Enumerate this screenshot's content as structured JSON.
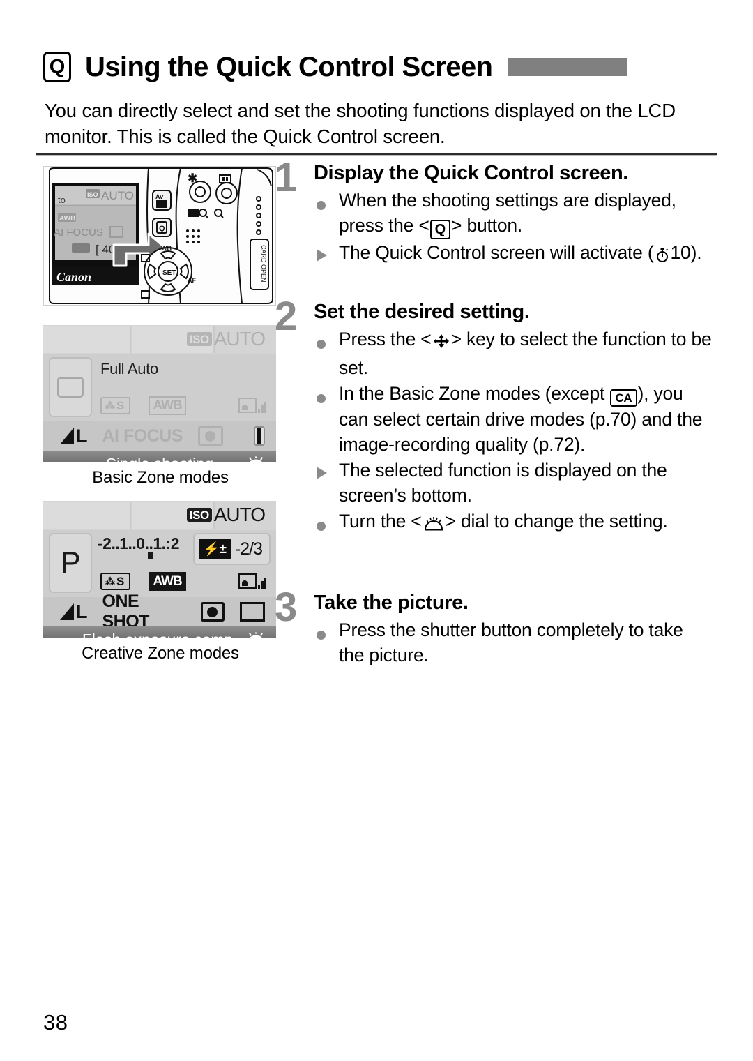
{
  "header": {
    "icon": "q-button-icon",
    "icon_label": "Q",
    "title": "Using the Quick Control Screen",
    "accent_bar_color": "#808080"
  },
  "intro": "You can directly select and set the shooting functions displayed on the LCD monitor. This is called the Quick Control screen.",
  "figures": {
    "camera": {
      "name": "camera-back-photo",
      "lcd_texts": {
        "mode": "to",
        "iso": "AUTO",
        "wb": "AWB",
        "af": "AI FOCUS",
        "iso_value": "400",
        "brand": "Canon"
      },
      "button_labels": {
        "exposure": "Av",
        "quick_control": "Q",
        "wb": "WB",
        "af": "AF",
        "set": "SET"
      },
      "card_door_label": "CARD OPEN"
    },
    "basic_zone": {
      "caption": "Basic Zone modes",
      "iso_tag": "ISO",
      "iso_value": "AUTO",
      "mode_name": "Full Auto",
      "picture_style": "S",
      "white_balance": "AWB",
      "quality": "L",
      "af_mode": "AI FOCUS",
      "status": "Single shooting"
    },
    "creative_zone": {
      "caption": "Creative Zone modes",
      "iso_tag": "ISO",
      "iso_value": "AUTO",
      "mode_letter": "P",
      "exposure_scale": "-2..1..0..1.:2",
      "flash_comp_icon": "flash-exposure-comp-icon",
      "flash_comp_value": "-2/3",
      "picture_style": "S",
      "white_balance": "AWB",
      "quality": "L",
      "af_mode": "ONE SHOT",
      "status": "Flash exposure comp."
    }
  },
  "steps": [
    {
      "number": "1",
      "title": "Display the Quick Control screen.",
      "bullets": [
        {
          "marker": "dot",
          "segments": [
            {
              "type": "text",
              "value": "When the shooting settings are displayed, press the <"
            },
            {
              "type": "icon",
              "value": "Q"
            },
            {
              "type": "text",
              "value": "> button."
            }
          ]
        },
        {
          "marker": "triangle",
          "segments": [
            {
              "type": "text",
              "value": "The Quick Control screen will activate ("
            },
            {
              "type": "icon",
              "value": "timer-icon"
            },
            {
              "type": "text",
              "value": "10)."
            }
          ]
        }
      ]
    },
    {
      "number": "2",
      "title": "Set the desired setting.",
      "bullets": [
        {
          "marker": "dot",
          "segments": [
            {
              "type": "text",
              "value": "Press the <"
            },
            {
              "type": "icon",
              "value": "cross-keys-icon"
            },
            {
              "type": "text",
              "value": "> key to select the function to be set."
            }
          ]
        },
        {
          "marker": "dot",
          "segments": [
            {
              "type": "text",
              "value": "In the Basic Zone modes (except "
            },
            {
              "type": "icon",
              "value": "CA"
            },
            {
              "type": "text",
              "value": "), you can select certain drive modes (p.70) and the image-recording quality (p.72)."
            }
          ]
        },
        {
          "marker": "triangle",
          "segments": [
            {
              "type": "text",
              "value": "The selected function is displayed on the screen’s bottom."
            }
          ]
        },
        {
          "marker": "dot",
          "segments": [
            {
              "type": "text",
              "value": "Turn the <"
            },
            {
              "type": "icon",
              "value": "main-dial-icon"
            },
            {
              "type": "text",
              "value": "> dial to change the setting."
            }
          ]
        }
      ]
    },
    {
      "number": "3",
      "title": "Take the picture.",
      "bullets": [
        {
          "marker": "dot",
          "segments": [
            {
              "type": "text",
              "value": "Press the shutter button completely to take the picture."
            }
          ]
        }
      ]
    }
  ],
  "step_text": {
    "s1_title": "Display the Quick Control screen.",
    "s1_b1_a": "When the shooting settings are displayed, press the <",
    "s1_b1_icon": "Q",
    "s1_b1_b": "> button.",
    "s1_b2_a": "The Quick Control screen will activate (",
    "s1_b2_b": "10).",
    "s2_title": "Set the desired setting.",
    "s2_b1_a": "Press the <",
    "s2_b1_b": "> key to select the function to be set.",
    "s2_b2_a": "In the Basic Zone modes (except ",
    "s2_b2_icon": "CA",
    "s2_b2_b": "), you can select certain drive modes (p.70) and the image-recording quality (p.72).",
    "s2_b3": "The selected function is displayed on the screen’s bottom.",
    "s2_b4_a": "Turn the <",
    "s2_b4_b": "> dial to change the setting.",
    "s3_title": "Take the picture.",
    "s3_b1": "Press the shutter button completely to take the picture."
  },
  "page_number": "38"
}
